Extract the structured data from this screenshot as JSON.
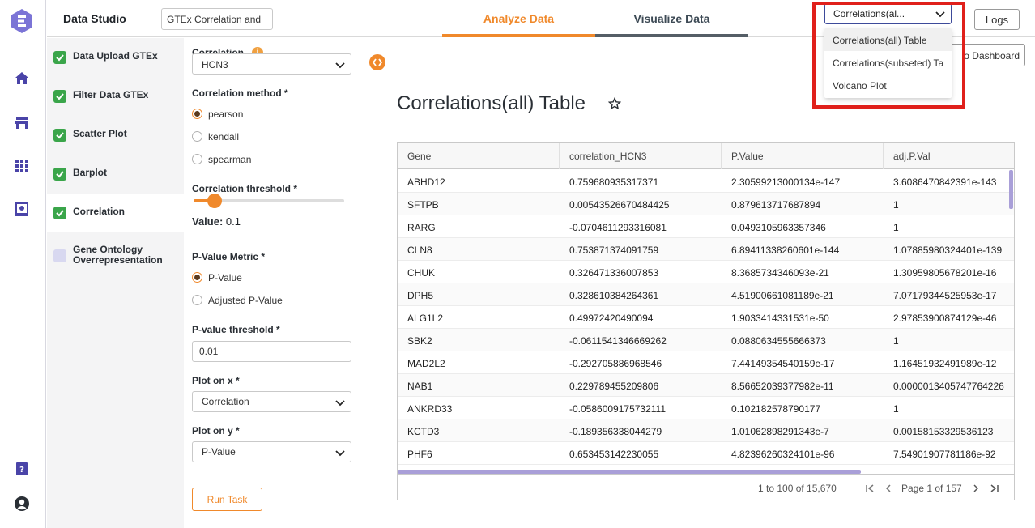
{
  "app": {
    "title": "Data Studio",
    "project_name": "GTEx Correlation and",
    "logs_label": "Logs"
  },
  "tabs": [
    {
      "label": "Analyze Data",
      "active": true
    },
    {
      "label": "Visualize Data",
      "active": false
    }
  ],
  "output_select": {
    "value": "Correlations(al...",
    "options": [
      "Correlations(all) Table",
      "Correlations(subseted) Ta",
      "Volcano Plot"
    ]
  },
  "dashboard_button_label": "o Dashboard",
  "steps": [
    {
      "label": "Data Upload GTEx",
      "done": true
    },
    {
      "label": "Filter Data GTEx",
      "done": true
    },
    {
      "label": "Scatter Plot",
      "done": true
    },
    {
      "label": "Barplot",
      "done": true
    },
    {
      "label": "Correlation",
      "done": true,
      "active": true
    },
    {
      "label": "Gene Ontology Overrepresentation",
      "done": false
    }
  ],
  "params": {
    "correlation_label": "Correlation",
    "correlation_value": "HCN3",
    "method_label": "Correlation method *",
    "methods": [
      "pearson",
      "kendall",
      "spearman"
    ],
    "method_selected": "pearson",
    "threshold_label": "Correlation threshold *",
    "threshold_value_label": "Value:",
    "threshold_value": "0.1",
    "threshold_fraction": 0.14,
    "pmetric_label": "P-Value Metric *",
    "pmetrics": [
      "P-Value",
      "Adjusted P-Value"
    ],
    "pmetric_selected": "P-Value",
    "pthreshold_label": "P-value threshold *",
    "pthreshold_value": "0.01",
    "plotx_label": "Plot on x *",
    "plotx_value": "Correlation",
    "ploty_label": "Plot on y *",
    "ploty_value": "P-Value",
    "run_label": "Run Task"
  },
  "main": {
    "title": "Correlations(all) Table",
    "columns": [
      "Gene",
      "correlation_HCN3",
      "P.Value",
      "adj.P.Val"
    ],
    "rows": [
      [
        "ABHD12",
        "0.759680935317371",
        "2.30599213000134e-147",
        "3.6086470842391e-143"
      ],
      [
        "SFTPB",
        "0.00543526670484425",
        "0.879613717687894",
        "1"
      ],
      [
        "RARG",
        "-0.0704611293316081",
        "0.0493105963357346",
        "1"
      ],
      [
        "CLN8",
        "0.753871374091759",
        "6.89411338260601e-144",
        "1.07885980324401e-139"
      ],
      [
        "CHUK",
        "0.326471336007853",
        "8.3685734346093e-21",
        "1.30959805678201e-16"
      ],
      [
        "DPH5",
        "0.328610384264361",
        "4.51900661081189e-21",
        "7.07179344525953e-17"
      ],
      [
        "ALG1L2",
        "0.49972420490094",
        "1.9033414331531e-50",
        "2.97853900874129e-46"
      ],
      [
        "SBK2",
        "-0.0611541346669262",
        "0.0880634555666373",
        "1"
      ],
      [
        "MAD2L2",
        "-0.292705886968546",
        "7.44149354540159e-17",
        "1.16451932491989e-12"
      ],
      [
        "NAB1",
        "0.229789455209806",
        "8.56652039377982e-11",
        "0.0000013405747764226"
      ],
      [
        "ANKRD33",
        "-0.0586009175732111",
        "0.102182578790177",
        "1"
      ],
      [
        "KCTD3",
        "-0.189356338044279",
        "1.01062898291343e-7",
        "0.00158153329536123"
      ],
      [
        "PHF6",
        "0.653453142230055",
        "4.82396260324101e-96",
        "7.54901907781186e-92"
      ]
    ],
    "pagination": {
      "summary": "1 to 100 of 15,670",
      "page_text": "Page 1 of 157"
    }
  },
  "colors": {
    "accent": "#f0892b",
    "success": "#3aa54a",
    "highlight": "#e0201b",
    "brand": "#7b74d6"
  }
}
